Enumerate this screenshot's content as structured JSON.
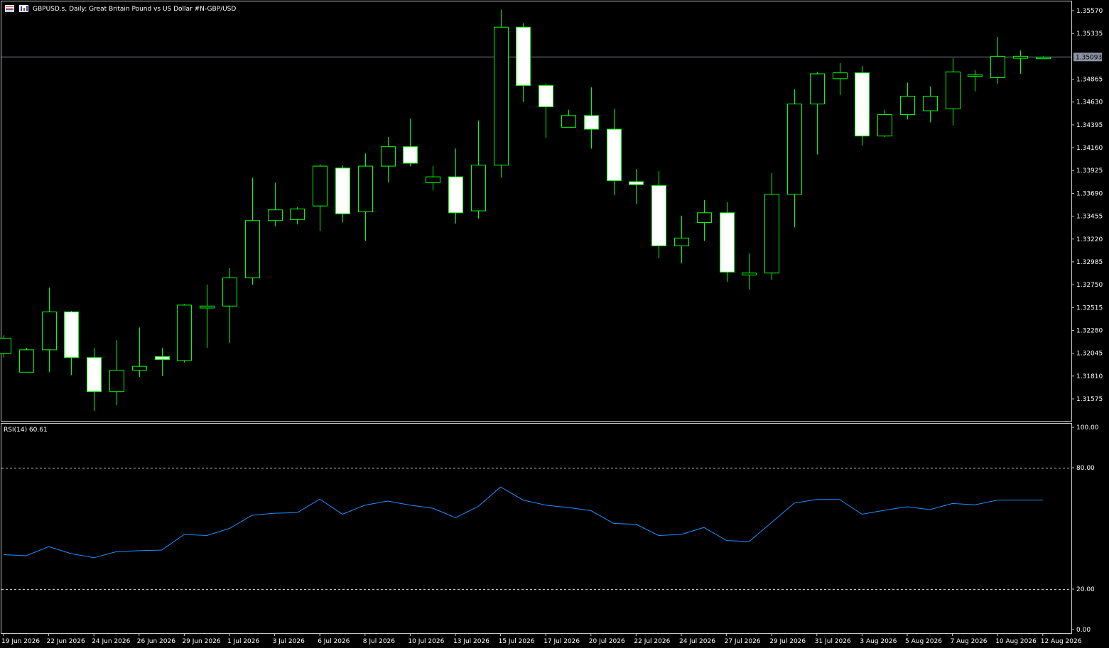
{
  "header": {
    "title": "GBPUSD.s, Daily:  Great Britain Pound vs US Dollar #N-GBP/USD",
    "icons": [
      "chart-window-icon",
      "bars-icon"
    ]
  },
  "price_label": "1.35093",
  "colors": {
    "background": "#000000",
    "bull_body": "#000000",
    "bear_body": "#ffffff",
    "candle_outline": "#00ff00",
    "wick": "#00ff00",
    "grid_frame": "#c8c8c8",
    "bid_line": "#6e7a88",
    "price_label_bg": "#8a93a3",
    "rsi_line": "#1e90ff",
    "level_line": "#c8c8c8"
  },
  "chart_data": [
    {
      "type": "candlestick",
      "title": "GBPUSD.s, Daily:  Great Britain Pound vs US Dollar #N-GBP/USD",
      "y_axis_ticks": [
        "1.35570",
        "1.35335",
        "1.35093",
        "1.34865",
        "1.34630",
        "1.34395",
        "1.34160",
        "1.33925",
        "1.33690",
        "1.33455",
        "1.33220",
        "1.32985",
        "1.32750",
        "1.32515",
        "1.32280",
        "1.32045",
        "1.31810",
        "1.31575"
      ],
      "ylim": [
        1.3138,
        1.3575
      ],
      "current_price": 1.35093,
      "x_axis_ticks": [
        "19 Jun 2026",
        "22 Jun 2026",
        "24 Jun 2026",
        "26 Jun 2026",
        "29 Jun 2026",
        "1 Jul 2026",
        "3 Jul 2026",
        "6 Jul 2026",
        "8 Jul 2026",
        "10 Jul 2026",
        "13 Jul 2026",
        "15 Jul 2026",
        "17 Jul 2026",
        "20 Jul 2026",
        "22 Jul 2026",
        "24 Jul 2026",
        "27 Jul 2026",
        "29 Jul 2026",
        "31 Jul 2026",
        "3 Aug 2026",
        "5 Aug 2026",
        "7 Aug 2026",
        "10 Aug 2026",
        "12 Aug 2026"
      ],
      "ohlc": [
        [
          1.3204,
          1.3223,
          1.32,
          1.322
        ],
        [
          1.3185,
          1.321,
          1.3185,
          1.3208
        ],
        [
          1.3208,
          1.3272,
          1.3185,
          1.3247
        ],
        [
          1.3247,
          1.3248,
          1.3182,
          1.32
        ],
        [
          1.32,
          1.321,
          1.3145,
          1.3165
        ],
        [
          1.3165,
          1.3218,
          1.3151,
          1.3187
        ],
        [
          1.3187,
          1.3231,
          1.318,
          1.3191
        ],
        [
          1.3201,
          1.321,
          1.3181,
          1.3198
        ],
        [
          1.3197,
          1.3255,
          1.3195,
          1.3254
        ],
        [
          1.3251,
          1.3275,
          1.321,
          1.3253
        ],
        [
          1.3253,
          1.3292,
          1.3215,
          1.3282
        ],
        [
          1.3282,
          1.3385,
          1.3275,
          1.3341
        ],
        [
          1.3341,
          1.338,
          1.3335,
          1.3352
        ],
        [
          1.3342,
          1.3355,
          1.3337,
          1.3353
        ],
        [
          1.3356,
          1.3399,
          1.333,
          1.3397
        ],
        [
          1.3395,
          1.3398,
          1.3339,
          1.3348
        ],
        [
          1.335,
          1.341,
          1.332,
          1.3397
        ],
        [
          1.3397,
          1.3427,
          1.338,
          1.3417
        ],
        [
          1.3417,
          1.3446,
          1.3397,
          1.34
        ],
        [
          1.338,
          1.3397,
          1.3372,
          1.3386
        ],
        [
          1.3386,
          1.3415,
          1.3338,
          1.3349
        ],
        [
          1.3351,
          1.3444,
          1.3343,
          1.3398
        ],
        [
          1.3398,
          1.3558,
          1.3385,
          1.354
        ],
        [
          1.354,
          1.3544,
          1.3463,
          1.348
        ],
        [
          1.348,
          1.3482,
          1.3426,
          1.3458
        ],
        [
          1.3437,
          1.3455,
          1.3437,
          1.3449
        ],
        [
          1.3449,
          1.3478,
          1.3415,
          1.3435
        ],
        [
          1.3435,
          1.3456,
          1.3367,
          1.3382
        ],
        [
          1.3381,
          1.3394,
          1.3358,
          1.3378
        ],
        [
          1.3377,
          1.3392,
          1.3302,
          1.3315
        ],
        [
          1.3315,
          1.3346,
          1.3297,
          1.3323
        ],
        [
          1.3339,
          1.3362,
          1.332,
          1.3349
        ],
        [
          1.3349,
          1.336,
          1.3278,
          1.3288
        ],
        [
          1.3285,
          1.3307,
          1.327,
          1.3287
        ],
        [
          1.3287,
          1.339,
          1.328,
          1.3368
        ],
        [
          1.3368,
          1.3476,
          1.3334,
          1.3461
        ],
        [
          1.3461,
          1.3494,
          1.3409,
          1.3492
        ],
        [
          1.3487,
          1.3503,
          1.347,
          1.3493
        ],
        [
          1.3493,
          1.35,
          1.3418,
          1.3428
        ],
        [
          1.3428,
          1.3455,
          1.3427,
          1.345
        ],
        [
          1.345,
          1.3483,
          1.3445,
          1.3469
        ],
        [
          1.3454,
          1.3479,
          1.3442,
          1.3469
        ],
        [
          1.3456,
          1.3508,
          1.3439,
          1.3494
        ],
        [
          1.349,
          1.3496,
          1.3474,
          1.3491
        ],
        [
          1.3488,
          1.353,
          1.3482,
          1.351
        ],
        [
          1.3508,
          1.3516,
          1.3492,
          1.351
        ],
        [
          1.3509,
          1.351,
          1.3508,
          1.3509
        ]
      ]
    },
    {
      "type": "line",
      "title": "RSI(14) 60.61",
      "series": [
        {
          "name": "RSI(14)",
          "values": [
            37.0,
            36.5,
            41.0,
            37.5,
            35.5,
            38.5,
            39.0,
            39.3,
            47.0,
            46.5,
            50.0,
            56.5,
            57.5,
            57.8,
            64.5,
            57.0,
            61.5,
            63.5,
            61.5,
            60.0,
            55.3,
            60.8,
            70.5,
            64.0,
            61.5,
            60.3,
            58.8,
            52.5,
            52.0,
            46.5,
            47.0,
            50.5,
            44.0,
            43.5,
            53.0,
            62.5,
            64.3,
            64.3,
            57.0,
            59.0,
            60.7,
            59.3,
            62.3,
            61.7,
            64.0,
            64.0,
            64.0
          ]
        }
      ],
      "ylim": [
        0,
        100
      ],
      "y_axis_ticks": [
        "100.00",
        "80.00",
        "20.00",
        "0.00"
      ],
      "levels": [
        80,
        20
      ]
    }
  ]
}
